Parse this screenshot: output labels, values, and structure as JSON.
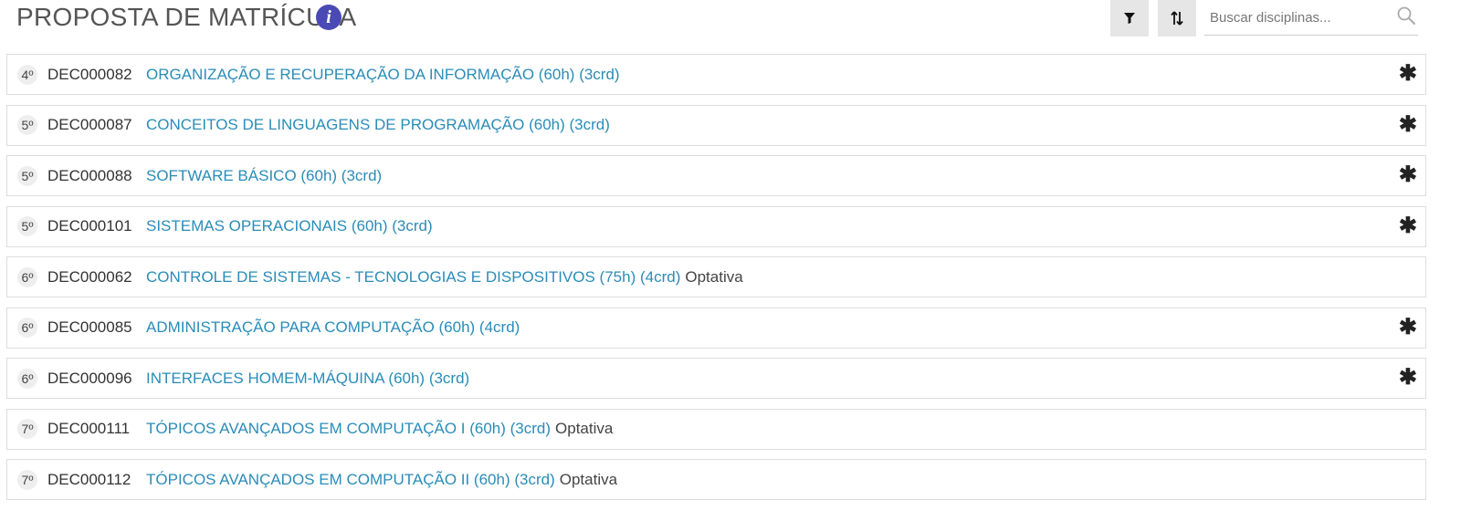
{
  "header": {
    "title": "PROPOSTA DE MATRÍCULA",
    "info_icon": "i"
  },
  "toolbar": {
    "filter_icon": "filter-icon",
    "sort_icon": "sort-icon"
  },
  "search": {
    "placeholder": "Buscar disciplinas...",
    "value": ""
  },
  "courses": [
    {
      "semester": "4º",
      "code": "DEC000082",
      "name": "ORGANIZAÇÃO E RECUPERAÇÃO DA INFORMAÇÃO (60h) (3crd)",
      "tag": "",
      "marker": "✱"
    },
    {
      "semester": "5º",
      "code": "DEC000087",
      "name": "CONCEITOS DE LINGUAGENS DE PROGRAMAÇÃO (60h) (3crd)",
      "tag": "",
      "marker": "✱"
    },
    {
      "semester": "5º",
      "code": "DEC000088",
      "name": "SOFTWARE BÁSICO (60h) (3crd)",
      "tag": "",
      "marker": "✱"
    },
    {
      "semester": "5º",
      "code": "DEC000101",
      "name": "SISTEMAS OPERACIONAIS (60h) (3crd)",
      "tag": "",
      "marker": "✱"
    },
    {
      "semester": "6º",
      "code": "DEC000062",
      "name": "CONTROLE DE SISTEMAS - TECNOLOGIAS E DISPOSITIVOS (75h) (4crd)",
      "tag": "Optativa",
      "marker": ""
    },
    {
      "semester": "6º",
      "code": "DEC000085",
      "name": "ADMINISTRAÇÃO PARA COMPUTAÇÃO (60h) (4crd)",
      "tag": "",
      "marker": "✱"
    },
    {
      "semester": "6º",
      "code": "DEC000096",
      "name": "INTERFACES HOMEM-MÁQUINA (60h) (3crd)",
      "tag": "",
      "marker": "✱"
    },
    {
      "semester": "7º",
      "code": "DEC000111",
      "name": "TÓPICOS AVANÇADOS EM COMPUTAÇÃO I (60h) (3crd)",
      "tag": "Optativa",
      "marker": ""
    },
    {
      "semester": "7º",
      "code": "DEC000112",
      "name": "TÓPICOS AVANÇADOS EM COMPUTAÇÃO II (60h) (3crd)",
      "tag": "Optativa",
      "marker": ""
    }
  ],
  "colors": {
    "link": "#2a8cb8",
    "info_icon_bg": "#4a4ab5",
    "toolbar_button_bg": "#e6e6e6",
    "row_border": "#dddddd"
  }
}
